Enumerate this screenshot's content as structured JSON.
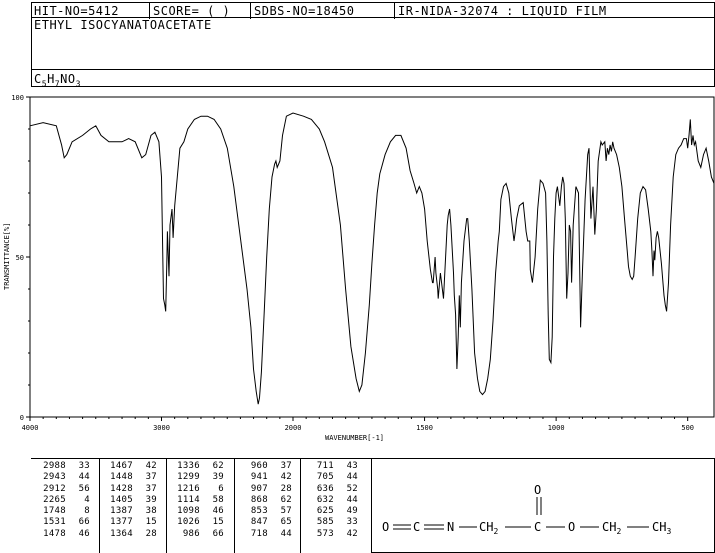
{
  "header": {
    "hit_no": "HIT-NO=5412",
    "score": "SCORE=  (   )",
    "sdbs_no": "SDBS-NO=18450",
    "ir_id": "IR-NIDA-32074 : LIQUID FILM",
    "compound_name": "ETHYL ISOCYANATOACETATE",
    "formula_base": "C",
    "formula_parts": [
      [
        "C",
        ""
      ],
      [
        "5",
        "sub"
      ],
      [
        "H",
        ""
      ],
      [
        "7",
        "sub"
      ],
      [
        "NO",
        ""
      ],
      [
        "3",
        "sub"
      ]
    ]
  },
  "chart_data": {
    "type": "line",
    "xlabel": "WAVENUMBER[-1]",
    "ylabel": "TRANSMITTANCE[%]",
    "xlim": [
      4000,
      400
    ],
    "ylim": [
      0,
      100
    ],
    "x_ticks": [
      "4000",
      "3000",
      "2000",
      "1500",
      "1000",
      "500"
    ],
    "y_ticks": [
      "0",
      "50",
      "100"
    ],
    "x_tick_values": [
      4000,
      3000,
      2000,
      1500,
      1000,
      500
    ],
    "y_tick_values": [
      0,
      50,
      100
    ],
    "series": [
      {
        "points": [
          [
            4000,
            91
          ],
          [
            3900,
            92
          ],
          [
            3800,
            91
          ],
          [
            3760,
            85
          ],
          [
            3740,
            81
          ],
          [
            3720,
            82
          ],
          [
            3680,
            86
          ],
          [
            3600,
            88
          ],
          [
            3540,
            90
          ],
          [
            3500,
            91
          ],
          [
            3460,
            88
          ],
          [
            3400,
            86
          ],
          [
            3300,
            86
          ],
          [
            3250,
            87
          ],
          [
            3200,
            86
          ],
          [
            3150,
            81
          ],
          [
            3120,
            82
          ],
          [
            3080,
            88
          ],
          [
            3050,
            89
          ],
          [
            3020,
            86
          ],
          [
            3000,
            75
          ],
          [
            2990,
            50
          ],
          [
            2985,
            37
          ],
          [
            2975,
            35
          ],
          [
            2968,
            33
          ],
          [
            2960,
            48
          ],
          [
            2955,
            58
          ],
          [
            2950,
            52
          ],
          [
            2943,
            44
          ],
          [
            2935,
            60
          ],
          [
            2920,
            65
          ],
          [
            2912,
            56
          ],
          [
            2900,
            66
          ],
          [
            2880,
            75
          ],
          [
            2860,
            84
          ],
          [
            2830,
            86
          ],
          [
            2800,
            90
          ],
          [
            2750,
            93
          ],
          [
            2700,
            94
          ],
          [
            2650,
            94
          ],
          [
            2600,
            93
          ],
          [
            2550,
            90
          ],
          [
            2500,
            84
          ],
          [
            2450,
            72
          ],
          [
            2400,
            56
          ],
          [
            2350,
            40
          ],
          [
            2320,
            28
          ],
          [
            2300,
            15
          ],
          [
            2280,
            8
          ],
          [
            2265,
            4
          ],
          [
            2255,
            6
          ],
          [
            2240,
            14
          ],
          [
            2220,
            32
          ],
          [
            2200,
            50
          ],
          [
            2180,
            65
          ],
          [
            2160,
            75
          ],
          [
            2140,
            79
          ],
          [
            2130,
            80
          ],
          [
            2120,
            78
          ],
          [
            2100,
            80
          ],
          [
            2080,
            88
          ],
          [
            2050,
            94
          ],
          [
            2000,
            95
          ],
          [
            1960,
            94
          ],
          [
            1930,
            93
          ],
          [
            1900,
            90
          ],
          [
            1880,
            86
          ],
          [
            1850,
            78
          ],
          [
            1820,
            60
          ],
          [
            1800,
            40
          ],
          [
            1780,
            22
          ],
          [
            1760,
            12
          ],
          [
            1748,
            8
          ],
          [
            1738,
            10
          ],
          [
            1725,
            20
          ],
          [
            1710,
            35
          ],
          [
            1700,
            48
          ],
          [
            1690,
            60
          ],
          [
            1680,
            70
          ],
          [
            1670,
            76
          ],
          [
            1650,
            82
          ],
          [
            1630,
            86
          ],
          [
            1610,
            88
          ],
          [
            1590,
            88
          ],
          [
            1570,
            84
          ],
          [
            1555,
            77
          ],
          [
            1540,
            73
          ],
          [
            1530,
            70
          ],
          [
            1520,
            72
          ],
          [
            1510,
            70
          ],
          [
            1500,
            65
          ],
          [
            1490,
            55
          ],
          [
            1478,
            46
          ],
          [
            1470,
            42
          ],
          [
            1467,
            42
          ],
          [
            1460,
            50
          ],
          [
            1457,
            45
          ],
          [
            1450,
            40
          ],
          [
            1448,
            37
          ],
          [
            1440,
            45
          ],
          [
            1428,
            37
          ],
          [
            1420,
            50
          ],
          [
            1414,
            60
          ],
          [
            1410,
            63
          ],
          [
            1405,
            65
          ],
          [
            1400,
            60
          ],
          [
            1390,
            45
          ],
          [
            1387,
            38
          ],
          [
            1382,
            32
          ],
          [
            1377,
            15
          ],
          [
            1372,
            25
          ],
          [
            1368,
            38
          ],
          [
            1364,
            28
          ],
          [
            1360,
            42
          ],
          [
            1350,
            55
          ],
          [
            1340,
            62
          ],
          [
            1336,
            62
          ],
          [
            1330,
            55
          ],
          [
            1320,
            40
          ],
          [
            1310,
            20
          ],
          [
            1299,
            12
          ],
          [
            1290,
            8
          ],
          [
            1280,
            7
          ],
          [
            1270,
            8
          ],
          [
            1260,
            12
          ],
          [
            1250,
            18
          ],
          [
            1240,
            30
          ],
          [
            1230,
            45
          ],
          [
            1220,
            55
          ],
          [
            1216,
            58
          ],
          [
            1210,
            68
          ],
          [
            1200,
            72
          ],
          [
            1190,
            73
          ],
          [
            1180,
            70
          ],
          [
            1170,
            62
          ],
          [
            1160,
            55
          ],
          [
            1155,
            58
          ],
          [
            1150,
            62
          ],
          [
            1140,
            66
          ],
          [
            1125,
            67
          ],
          [
            1114,
            58
          ],
          [
            1108,
            55
          ],
          [
            1100,
            55
          ],
          [
            1098,
            46
          ],
          [
            1090,
            42
          ],
          [
            1080,
            50
          ],
          [
            1070,
            65
          ],
          [
            1060,
            74
          ],
          [
            1050,
            73
          ],
          [
            1040,
            70
          ],
          [
            1035,
            55
          ],
          [
            1030,
            32
          ],
          [
            1026,
            18
          ],
          [
            1020,
            17
          ],
          [
            1015,
            25
          ],
          [
            1010,
            50
          ],
          [
            1005,
            62
          ],
          [
            1000,
            70
          ],
          [
            995,
            72
          ],
          [
            986,
            66
          ],
          [
            980,
            72
          ],
          [
            975,
            75
          ],
          [
            970,
            73
          ],
          [
            965,
            62
          ],
          [
            960,
            37
          ],
          [
            955,
            45
          ],
          [
            950,
            60
          ],
          [
            945,
            58
          ],
          [
            941,
            42
          ],
          [
            935,
            60
          ],
          [
            925,
            72
          ],
          [
            915,
            70
          ],
          [
            907,
            28
          ],
          [
            900,
            45
          ],
          [
            890,
            68
          ],
          [
            880,
            82
          ],
          [
            875,
            84
          ],
          [
            868,
            62
          ],
          [
            860,
            72
          ],
          [
            853,
            57
          ],
          [
            847,
            65
          ],
          [
            840,
            80
          ],
          [
            830,
            86
          ],
          [
            825,
            85
          ],
          [
            815,
            86
          ],
          [
            810,
            80
          ],
          [
            805,
            84
          ],
          [
            800,
            82
          ],
          [
            795,
            85
          ],
          [
            790,
            83
          ],
          [
            785,
            86
          ],
          [
            780,
            84
          ],
          [
            770,
            82
          ],
          [
            760,
            78
          ],
          [
            750,
            72
          ],
          [
            740,
            62
          ],
          [
            730,
            52
          ],
          [
            725,
            47
          ],
          [
            718,
            44
          ],
          [
            711,
            43
          ],
          [
            705,
            44
          ],
          [
            700,
            50
          ],
          [
            690,
            62
          ],
          [
            680,
            70
          ],
          [
            670,
            72
          ],
          [
            660,
            71
          ],
          [
            650,
            65
          ],
          [
            640,
            58
          ],
          [
            636,
            52
          ],
          [
            632,
            44
          ],
          [
            628,
            52
          ],
          [
            625,
            49
          ],
          [
            620,
            56
          ],
          [
            615,
            58
          ],
          [
            610,
            56
          ],
          [
            600,
            48
          ],
          [
            590,
            38
          ],
          [
            585,
            35
          ],
          [
            580,
            33
          ],
          [
            573,
            42
          ],
          [
            565,
            60
          ],
          [
            555,
            75
          ],
          [
            545,
            82
          ],
          [
            535,
            84
          ],
          [
            525,
            85
          ],
          [
            515,
            87
          ],
          [
            505,
            87
          ],
          [
            500,
            84
          ],
          [
            495,
            88
          ],
          [
            490,
            93
          ],
          [
            485,
            85
          ],
          [
            480,
            88
          ],
          [
            475,
            85
          ],
          [
            470,
            86
          ],
          [
            460,
            80
          ],
          [
            450,
            78
          ],
          [
            440,
            82
          ],
          [
            430,
            84
          ],
          [
            420,
            80
          ],
          [
            410,
            75
          ],
          [
            400,
            73
          ]
        ]
      }
    ]
  },
  "peak_table": {
    "columns": [
      [
        [
          "2988",
          "33"
        ],
        [
          "2943",
          "44"
        ],
        [
          "2912",
          "56"
        ],
        [
          "2265",
          "4"
        ],
        [
          "1748",
          "8"
        ],
        [
          "1531",
          "66"
        ],
        [
          "1478",
          "46"
        ]
      ],
      [
        [
          "1467",
          "42"
        ],
        [
          "1448",
          "37"
        ],
        [
          "1428",
          "37"
        ],
        [
          "1405",
          "39"
        ],
        [
          "1387",
          "38"
        ],
        [
          "1377",
          "15"
        ],
        [
          "1364",
          "28"
        ]
      ],
      [
        [
          "1336",
          "62"
        ],
        [
          "1299",
          "39"
        ],
        [
          "1216",
          "6"
        ],
        [
          "1114",
          "58"
        ],
        [
          "1098",
          "46"
        ],
        [
          "1026",
          "15"
        ],
        [
          "986",
          "66"
        ]
      ],
      [
        [
          "960",
          "37"
        ],
        [
          "941",
          "42"
        ],
        [
          "907",
          "28"
        ],
        [
          "868",
          "62"
        ],
        [
          "853",
          "57"
        ],
        [
          "847",
          "65"
        ],
        [
          "718",
          "44"
        ]
      ],
      [
        [
          "711",
          "43"
        ],
        [
          "705",
          "44"
        ],
        [
          "636",
          "52"
        ],
        [
          "632",
          "44"
        ],
        [
          "625",
          "49"
        ],
        [
          "585",
          "33"
        ],
        [
          "573",
          "42"
        ]
      ]
    ]
  },
  "structure": {
    "atoms": [
      "O",
      "C",
      "N",
      "CH",
      "2",
      "C",
      "O",
      "O",
      "CH",
      "2",
      "CH",
      "3"
    ]
  }
}
